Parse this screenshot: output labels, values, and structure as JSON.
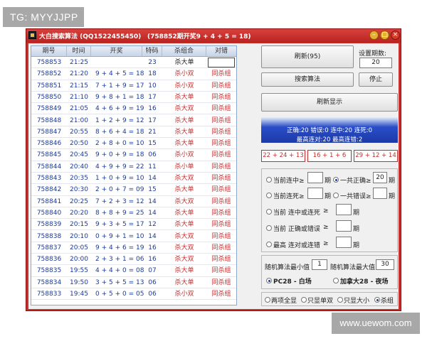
{
  "watermarks": {
    "top_left": "TG: MYYJJPP",
    "bottom_right": "www.uewom.com"
  },
  "window": {
    "title": "大白搜索算法 (QQ1522455450)",
    "info": "(758852期开奖9 + 4 + 5 = 18)",
    "controls": {
      "minimize": "–",
      "maximize": "□",
      "close": "×"
    }
  },
  "table": {
    "headers": [
      "期号",
      "时间",
      "开奖",
      "特码",
      "杀组合",
      "对错"
    ],
    "rows": [
      {
        "period": "758853",
        "time": "21:25",
        "draw": "",
        "code": "23",
        "combo": "杀大单",
        "result": ""
      },
      {
        "period": "758852",
        "time": "21:20",
        "draw": "9 + 4 + 5 = 18",
        "code": "18",
        "combo": "杀小双",
        "result": "同杀组"
      },
      {
        "period": "758851",
        "time": "21:15",
        "draw": "7 + 1 + 9 = 17",
        "code": "10",
        "combo": "杀小双",
        "result": "同杀组"
      },
      {
        "period": "758850",
        "time": "21:10",
        "draw": "9 + 8 + 1 = 18",
        "code": "17",
        "combo": "杀大单",
        "result": "同杀组"
      },
      {
        "period": "758849",
        "time": "21:05",
        "draw": "4 + 6 + 9 = 19",
        "code": "16",
        "combo": "杀大双",
        "result": "同杀组"
      },
      {
        "period": "758848",
        "time": "21:00",
        "draw": "1 + 2 + 9 = 12",
        "code": "17",
        "combo": "杀大单",
        "result": "同杀组"
      },
      {
        "period": "758847",
        "time": "20:55",
        "draw": "8 + 6 + 4 = 18",
        "code": "21",
        "combo": "杀大单",
        "result": "同杀组"
      },
      {
        "period": "758846",
        "time": "20:50",
        "draw": "2 + 8 + 0 = 10",
        "code": "15",
        "combo": "杀大单",
        "result": "同杀组"
      },
      {
        "period": "758845",
        "time": "20:45",
        "draw": "9 + 0 + 9 = 18",
        "code": "06",
        "combo": "杀小双",
        "result": "同杀组"
      },
      {
        "period": "758844",
        "time": "20:40",
        "draw": "4 + 9 + 9 = 22",
        "code": "11",
        "combo": "杀小单",
        "result": "同杀组"
      },
      {
        "period": "758843",
        "time": "20:35",
        "draw": "1 + 0 + 9 = 10",
        "code": "14",
        "combo": "杀大双",
        "result": "同杀组"
      },
      {
        "period": "758842",
        "time": "20:30",
        "draw": "2 + 0 + 7 = 09",
        "code": "15",
        "combo": "杀大单",
        "result": "同杀组"
      },
      {
        "period": "758841",
        "time": "20:25",
        "draw": "7 + 2 + 3 = 12",
        "code": "14",
        "combo": "杀大双",
        "result": "同杀组"
      },
      {
        "period": "758840",
        "time": "20:20",
        "draw": "8 + 8 + 9 = 25",
        "code": "14",
        "combo": "杀大单",
        "result": "同杀组"
      },
      {
        "period": "758839",
        "time": "20:15",
        "draw": "9 + 3 + 5 = 17",
        "code": "12",
        "combo": "杀大单",
        "result": "同杀组"
      },
      {
        "period": "758838",
        "time": "20:10",
        "draw": "0 + 9 + 1 = 10",
        "code": "14",
        "combo": "杀大双",
        "result": "同杀组"
      },
      {
        "period": "758837",
        "time": "20:05",
        "draw": "9 + 4 + 6 = 19",
        "code": "16",
        "combo": "杀大双",
        "result": "同杀组"
      },
      {
        "period": "758836",
        "time": "20:00",
        "draw": "2 + 3 + 1 = 06",
        "code": "16",
        "combo": "杀大双",
        "result": "同杀组"
      },
      {
        "period": "758835",
        "time": "19:55",
        "draw": "4 + 4 + 0 = 08",
        "code": "07",
        "combo": "杀大单",
        "result": "同杀组"
      },
      {
        "period": "758834",
        "time": "19:50",
        "draw": "3 + 5 + 5 = 13",
        "code": "06",
        "combo": "杀大单",
        "result": "同杀组"
      },
      {
        "period": "758833",
        "time": "19:45",
        "draw": "0 + 5 + 0 = 05",
        "code": "06",
        "combo": "杀小双",
        "result": "同杀组"
      }
    ]
  },
  "controls": {
    "refresh_button": "刷新(95)",
    "period_setting_label": "设置期数:",
    "period_setting_value": "20",
    "search_button": "搜索算法",
    "stop_button": "停止",
    "refresh_display_button": "刷新显示"
  },
  "stats": {
    "line1": "正确:20 错误:0 连中:20 连死:0",
    "line2": "最高连对:20 最高连错:2"
  },
  "predictions": [
    "22 + 24 + 13",
    "16 + 1 + 6",
    "29 + 12 + 14"
  ],
  "filters": {
    "current_streak_hit": "当前连中≥",
    "current_streak_hit_unit": "期",
    "total_correct": "一共正确≥",
    "total_correct_value": "20",
    "total_correct_unit": "期",
    "current_streak_miss": "当前连死≥",
    "current_streak_miss_unit": "期",
    "total_wrong": "一共错误≥",
    "total_wrong_unit": "期",
    "current_hit_or_miss": "当前 连中或连死",
    "current_hit_or_miss_op": "≥",
    "current_hit_or_miss_unit": "期",
    "current_correct_or_wrong": "当前 正确或错误",
    "current_correct_or_wrong_op": "≥",
    "current_correct_or_wrong_unit": "期",
    "highest_pair_or_wrong": "最高 连对或连错",
    "highest_pair_or_wrong_op": "≥",
    "highest_pair_or_wrong_unit": "期"
  },
  "random": {
    "min_label": "随机算法最小值",
    "min_value": "1",
    "max_label": "随机算法最大值",
    "max_value": "30",
    "mode_pc28": "PC28 - 白场",
    "mode_canada": "加拿大28 - 夜场"
  },
  "display_options": [
    "两项全显",
    "只显单双",
    "只显大小",
    "杀组"
  ],
  "colors": {
    "title_bar": "#c9302c",
    "accent_blue": "#1a3a9a",
    "red_text": "#c03030"
  }
}
